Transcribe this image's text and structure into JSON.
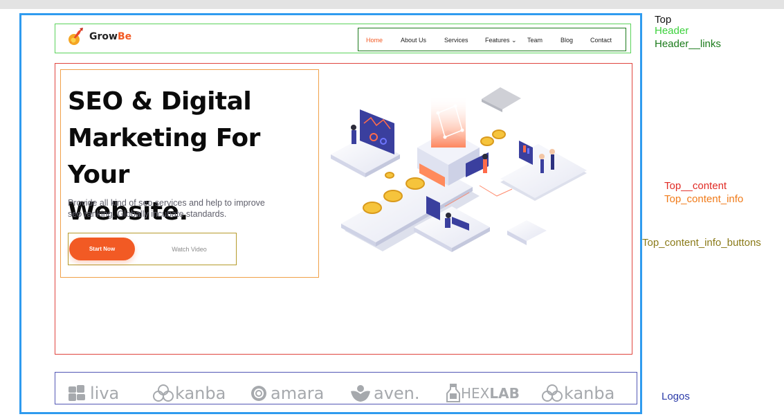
{
  "page": {
    "brand": {
      "prefix": "Grow",
      "suffix": "Be"
    },
    "nav": [
      {
        "label": "Home"
      },
      {
        "label": "About Us"
      },
      {
        "label": "Services"
      },
      {
        "label": "Features ⌄"
      },
      {
        "label": "Team"
      },
      {
        "label": "Blog"
      },
      {
        "label": "Contact"
      }
    ],
    "hero": {
      "title_lines": [
        "SEO & Digital",
        "Marketing For Your",
        "Website."
      ],
      "description_lines": [
        "Provide all kind of seo services and help to improve",
        "seo ranking. Globally incubate standards."
      ],
      "primary_button": "Start Now",
      "secondary_button": "Watch Video"
    },
    "logos": [
      {
        "name": "liva",
        "icon": "puzzle-icon"
      },
      {
        "name": "kanba",
        "icon": "knot-icon"
      },
      {
        "name": "amara",
        "icon": "ring-icon"
      },
      {
        "name": "aven.",
        "icon": "leaf-icon"
      },
      {
        "name": "HEX",
        "name_bold": "LAB",
        "icon": "flask-icon"
      },
      {
        "name": "kanba",
        "icon": "knot-icon"
      }
    ]
  },
  "annotations": {
    "top": "Top",
    "header": "Header",
    "header_links": "Header__links",
    "top_content": "Top__content",
    "top_content_info": "Top_content_info",
    "top_content_info_buttons": "Top_content_info_buttons",
    "logos": "Logos"
  },
  "colors": {
    "accent": "#f25a24",
    "frame_top": "#2f9bef",
    "frame_header": "#5ad35a",
    "frame_links": "#1a7a1a",
    "frame_content": "#e0443e",
    "frame_info": "#f0a048",
    "frame_buttons": "#b59a2a",
    "frame_logos": "#5257b5"
  }
}
